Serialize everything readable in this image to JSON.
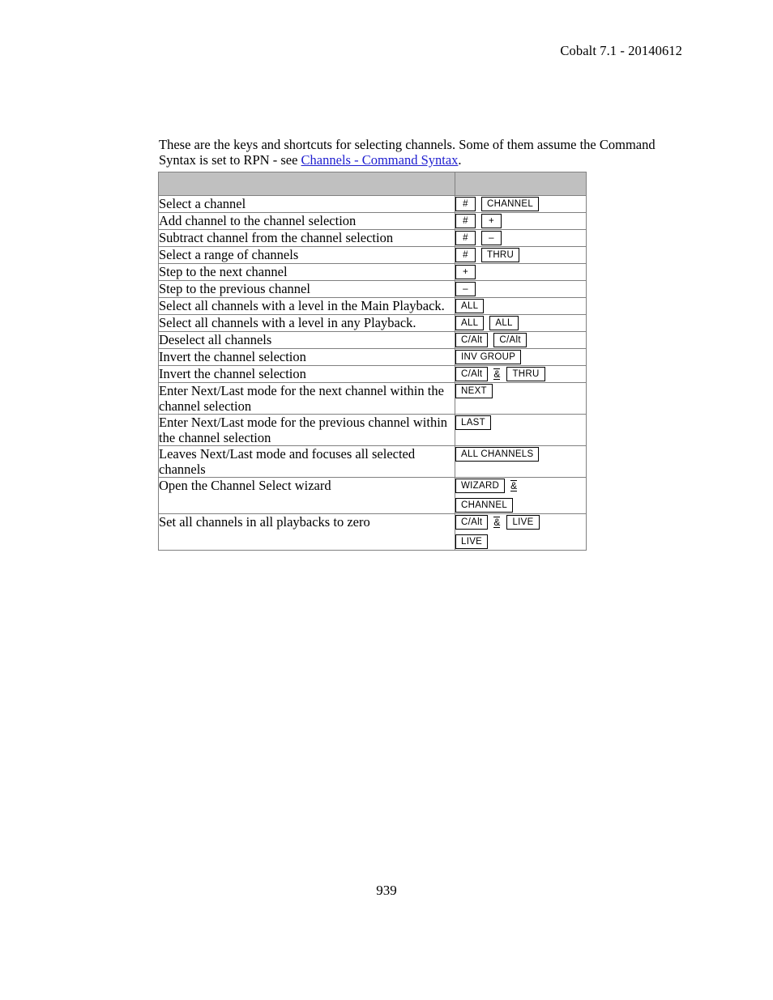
{
  "document": {
    "header_text": "Cobalt 7.1 - 20140612",
    "page_number": "939",
    "intro": {
      "text_before": "These are the keys and shortcuts for selecting channels. Some of them assume the Command Syntax is set to RPN - see ",
      "link_text": "Channels - Command Syntax",
      "text_after": "."
    }
  },
  "table": {
    "header": {
      "description_column": "",
      "keys_column": ""
    },
    "rows": [
      {
        "description": "Select a channel",
        "keys": [
          [
            {
              "type": "key",
              "label": "#"
            },
            {
              "type": "key",
              "label": "CHANNEL"
            }
          ]
        ]
      },
      {
        "description": "Add channel to the channel selection",
        "keys": [
          [
            {
              "type": "key",
              "label": "#"
            },
            {
              "type": "key",
              "label": "+"
            }
          ]
        ]
      },
      {
        "description": "Subtract channel from the channel selection",
        "keys": [
          [
            {
              "type": "key",
              "label": "#"
            },
            {
              "type": "key",
              "label": "–"
            }
          ]
        ]
      },
      {
        "description": "Select a range of channels",
        "keys": [
          [
            {
              "type": "key",
              "label": "#"
            },
            {
              "type": "key",
              "label": "THRU"
            }
          ]
        ]
      },
      {
        "description": "Step to the next channel",
        "keys": [
          [
            {
              "type": "key",
              "label": "+"
            }
          ]
        ]
      },
      {
        "description": "Step to the previous channel",
        "keys": [
          [
            {
              "type": "key",
              "label": "–"
            }
          ]
        ]
      },
      {
        "description": "Select all channels with a level in the Main Playback.",
        "keys": [
          [
            {
              "type": "key",
              "label": "ALL"
            }
          ]
        ]
      },
      {
        "description": "Select all channels with a level in any Playback.",
        "keys": [
          [
            {
              "type": "key",
              "label": "ALL"
            },
            {
              "type": "key",
              "label": "ALL"
            }
          ]
        ]
      },
      {
        "description": "Deselect all channels",
        "keys": [
          [
            {
              "type": "key",
              "label": "C/Alt"
            },
            {
              "type": "key",
              "label": "C/Alt"
            }
          ]
        ]
      },
      {
        "description": "Invert the channel selection",
        "keys": [
          [
            {
              "type": "key",
              "label": "INV GROUP"
            }
          ]
        ]
      },
      {
        "description": "Invert the channel selection",
        "keys": [
          [
            {
              "type": "key",
              "label": "C/Alt"
            },
            {
              "type": "sep",
              "label": "&"
            },
            {
              "type": "key",
              "label": "THRU"
            }
          ]
        ]
      },
      {
        "description": "Enter Next/Last mode for the next channel within the channel selection",
        "keys": [
          [
            {
              "type": "key",
              "label": "NEXT"
            }
          ]
        ]
      },
      {
        "description": "Enter Next/Last mode for the previous channel within the channel selection",
        "keys": [
          [
            {
              "type": "key",
              "label": "LAST"
            }
          ]
        ]
      },
      {
        "description": "Leaves Next/Last mode and focuses all selected channels",
        "keys": [
          [
            {
              "type": "key",
              "label": "ALL CHANNELS"
            }
          ]
        ]
      },
      {
        "description": "Open the Channel Select wizard",
        "keys": [
          [
            {
              "type": "key",
              "label": "WIZARD"
            },
            {
              "type": "sep",
              "label": "&"
            }
          ],
          [
            {
              "type": "key",
              "label": "CHANNEL"
            }
          ]
        ]
      },
      {
        "description": "Set all channels in all playbacks to zero",
        "keys": [
          [
            {
              "type": "key",
              "label": "C/Alt"
            },
            {
              "type": "sep",
              "label": "&"
            },
            {
              "type": "key",
              "label": "LIVE"
            }
          ],
          [
            {
              "type": "key",
              "label": "LIVE"
            }
          ]
        ]
      }
    ]
  },
  "colors": {
    "header_row_background": "#c0c0c0",
    "link": "#2020d0",
    "border": "#808080",
    "text": "#000000"
  }
}
